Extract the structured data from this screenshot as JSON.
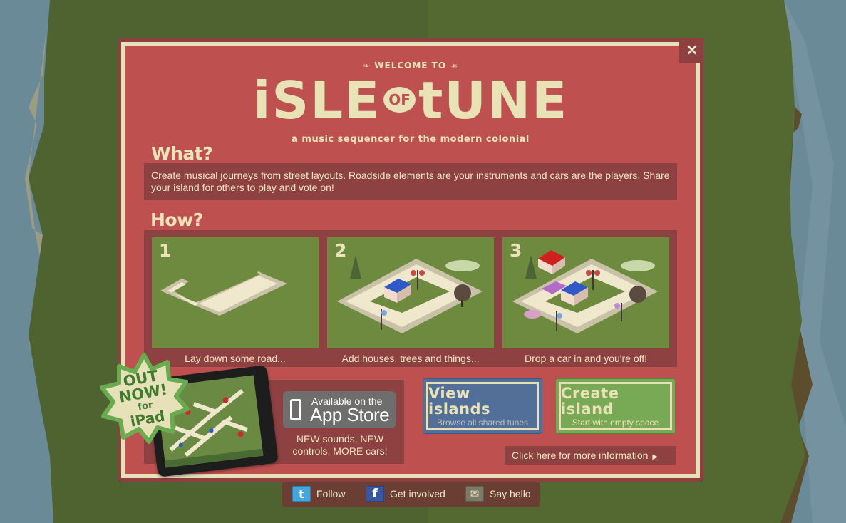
{
  "modal": {
    "close_label": "×",
    "welcome_text": "WELCOME TO",
    "logo": {
      "part1": "iSLE",
      "of": "OF",
      "part2": "tUNE"
    },
    "tagline": "a music sequencer for the modern colonial"
  },
  "what": {
    "heading": "What?",
    "description": "Create musical journeys from street layouts.  Roadside elements are your instruments and cars are the players.  Share your island for others to play and vote on!"
  },
  "how": {
    "heading": "How?",
    "steps": [
      {
        "number": "1",
        "caption": "Lay down some road..."
      },
      {
        "number": "2",
        "caption": "Add houses, trees and things..."
      },
      {
        "number": "3",
        "caption": "Drop a car in and you're off!"
      }
    ]
  },
  "ipad": {
    "badge": {
      "line1": "OUT",
      "line2": "NOW!",
      "line3": "for",
      "line4": "iPad"
    },
    "appstore": {
      "small": "Available on the",
      "big": "App Store"
    },
    "note": "NEW sounds, NEW controls, MORE cars!"
  },
  "actions": {
    "view": {
      "title": "View  islands",
      "subtitle": "Browse all shared tunes"
    },
    "create": {
      "title": "Create  island",
      "subtitle": "Start with empty space"
    },
    "more_info": "Click here for more information",
    "more_info_arrow": "▶"
  },
  "social": {
    "items": [
      {
        "icon": "twitter-icon",
        "glyph": "t",
        "label": "Follow"
      },
      {
        "icon": "facebook-icon",
        "glyph": "f",
        "label": "Get involved"
      },
      {
        "icon": "mail-icon",
        "glyph": "✉",
        "label": "Say hello"
      }
    ]
  },
  "colors": {
    "panel_red": "#be5150",
    "panel_dark": "#8e4141",
    "cream": "#e7e1b9",
    "view_blue": "#526f99",
    "create_green": "#78a955",
    "grass": "#4f6330",
    "water": "#6b8a98"
  }
}
